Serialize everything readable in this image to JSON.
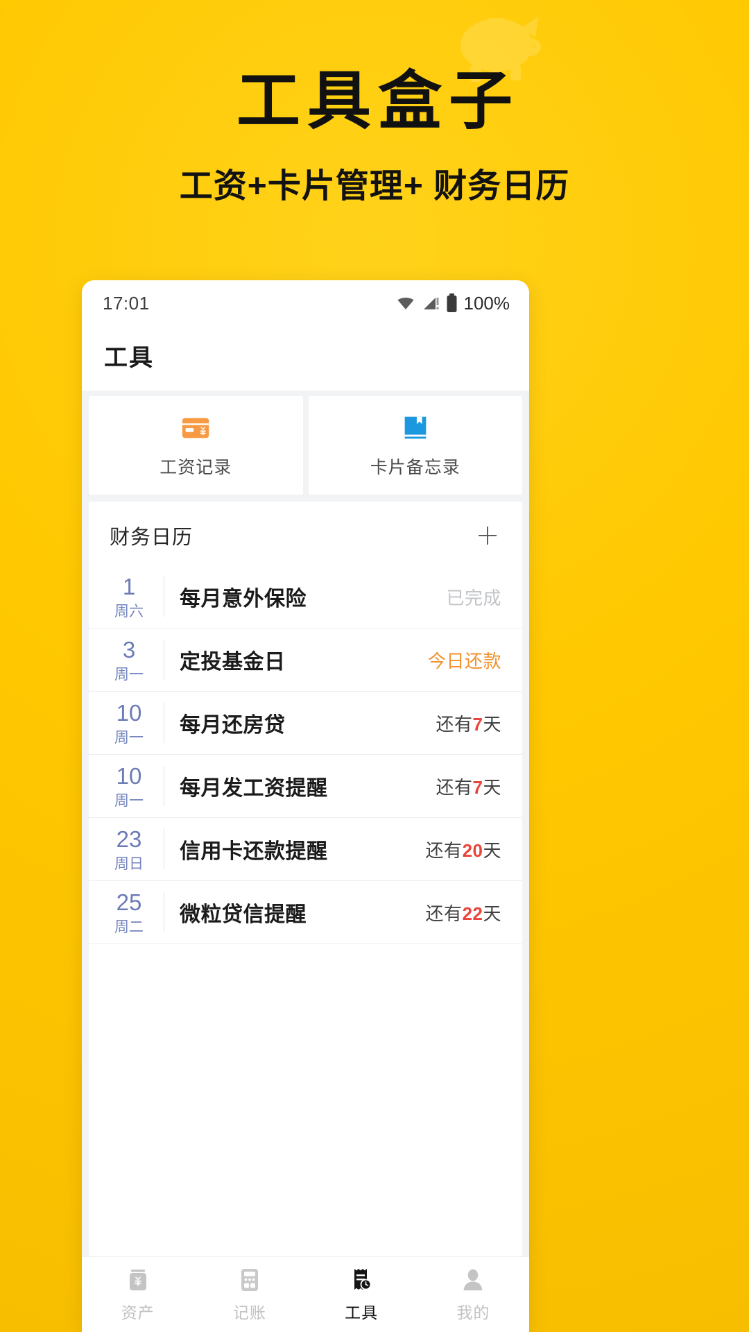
{
  "promo": {
    "title": "工具盒子",
    "subtitle": "工资+卡片管理+ 财务日历",
    "bg_color": "#FFC800",
    "piggy_icon": "piggy-bank-icon"
  },
  "phone": {
    "status_bar": {
      "time": "17:01",
      "wifi_icon": "wifi-icon",
      "signal_icon": "cellular-signal-icon",
      "battery_icon": "battery-icon",
      "battery_text": "100%"
    },
    "app_bar": {
      "title": "工具"
    },
    "tools": [
      {
        "label": "工资记录",
        "icon": "salary-card-icon",
        "color": "#F79A43"
      },
      {
        "label": "卡片备忘录",
        "icon": "card-notebook-icon",
        "color": "#1C98E0"
      }
    ],
    "calendar": {
      "title": "财务日历",
      "add_icon": "plus-icon",
      "rows": [
        {
          "day": "1",
          "weekday": "周六",
          "title": "每月意外保险",
          "status": "已完成",
          "status_type": "done"
        },
        {
          "day": "3",
          "weekday": "周一",
          "title": "定投基金日",
          "status": "今日还款",
          "status_type": "today"
        },
        {
          "day": "10",
          "weekday": "周一",
          "title": "每月还房贷",
          "status": "还有7天",
          "status_type": "count",
          "status_prefix": "还有",
          "status_number": "7",
          "status_suffix": "天"
        },
        {
          "day": "10",
          "weekday": "周一",
          "title": "每月发工资提醒",
          "status": "还有7天",
          "status_type": "count",
          "status_prefix": "还有",
          "status_number": "7",
          "status_suffix": "天"
        },
        {
          "day": "23",
          "weekday": "周日",
          "title": "信用卡还款提醒",
          "status": "还有20天",
          "status_type": "count",
          "status_prefix": "还有",
          "status_number": "20",
          "status_suffix": "天"
        },
        {
          "day": "25",
          "weekday": "周二",
          "title": "微粒贷信提醒",
          "status": "还有22天",
          "status_type": "count",
          "status_prefix": "还有",
          "status_number": "22",
          "status_suffix": "天"
        }
      ]
    },
    "tabs": [
      {
        "label": "资产",
        "icon": "money-jar-icon",
        "active": false
      },
      {
        "label": "记账",
        "icon": "calculator-icon",
        "active": false
      },
      {
        "label": "工具",
        "icon": "receipt-clock-icon",
        "active": true
      },
      {
        "label": "我的",
        "icon": "person-icon",
        "active": false
      }
    ]
  }
}
